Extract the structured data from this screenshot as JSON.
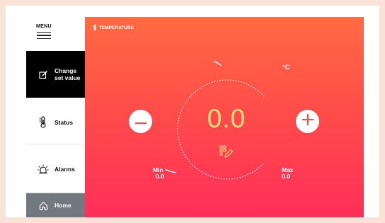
{
  "sidebar": {
    "menu_label": "MENU",
    "items": [
      {
        "label": "Change\nset value",
        "icon": "edit-icon",
        "active": true
      },
      {
        "label": "Status",
        "icon": "thermometer-icon"
      },
      {
        "label": "Alarms",
        "icon": "alarm-light-icon"
      },
      {
        "label": "Home",
        "icon": "home-icon"
      }
    ]
  },
  "panel": {
    "title": "TEMPERATURE",
    "unit": "°C",
    "value": "0.0",
    "min_label": "Min",
    "min_value": "0.0",
    "max_label": "Max",
    "max_value": "0.0"
  },
  "colors": {
    "panel_gradient_top": "#ff6a42",
    "panel_gradient_bottom": "#ff2e5a",
    "value_color": "#ffe07a",
    "active_nav": "#000000",
    "home_nav": "#717880"
  }
}
